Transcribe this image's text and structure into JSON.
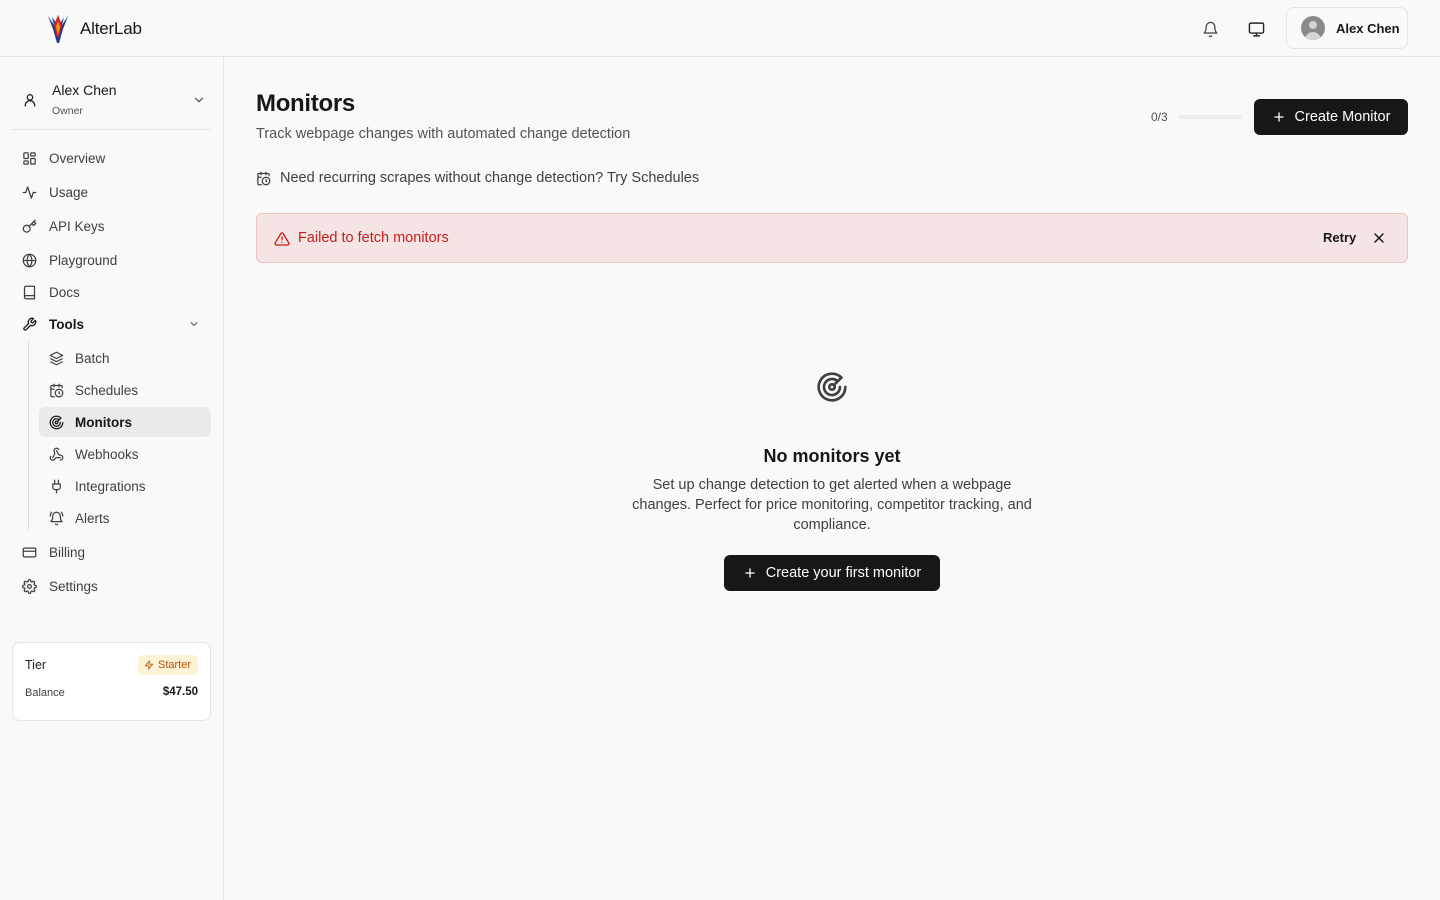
{
  "header": {
    "brand_name": "AlterLab",
    "logo_icon": "alterlab-logo",
    "notification_icon": "bell-icon",
    "display_icon": "monitor-icon",
    "user_name": "Alex Chen"
  },
  "sidebar": {
    "org": {
      "name": "Alex Chen",
      "role": "Owner"
    },
    "items": [
      {
        "label": "Overview",
        "icon": "layout-grid-icon"
      },
      {
        "label": "Usage",
        "icon": "activity-icon"
      },
      {
        "label": "API Keys",
        "icon": "key-icon"
      },
      {
        "label": "Playground",
        "icon": "globe-icon"
      },
      {
        "label": "Docs",
        "icon": "book-icon"
      },
      {
        "label": "Tools",
        "icon": "wrench-icon"
      }
    ],
    "tools": [
      {
        "label": "Batch",
        "icon": "layers-icon"
      },
      {
        "label": "Schedules",
        "icon": "calendar-clock-icon"
      },
      {
        "label": "Monitors",
        "icon": "radar-icon",
        "active": true
      },
      {
        "label": "Webhooks",
        "icon": "webhook-icon"
      },
      {
        "label": "Integrations",
        "icon": "plug-icon"
      },
      {
        "label": "Alerts",
        "icon": "bell-ring-icon"
      }
    ],
    "bottom_items": [
      {
        "label": "Billing",
        "icon": "credit-card-icon"
      },
      {
        "label": "Settings",
        "icon": "settings-icon"
      }
    ],
    "tier_card": {
      "tier_label": "Tier",
      "tier_value": "Starter",
      "balance_label": "Balance",
      "balance_value": "$47.50"
    }
  },
  "main": {
    "title": "Monitors",
    "subtitle": "Track webpage changes with automated change detection",
    "quota_text": "0/3",
    "quota_fraction": 0,
    "create_button": "Create Monitor",
    "hint_text": "Need recurring scrapes without change detection? Try Schedules",
    "alert": {
      "message": "Failed to fetch monitors",
      "retry_label": "Retry"
    },
    "empty_state": {
      "title": "No monitors yet",
      "description": "Set up change detection to get alerted when a webpage changes. Perfect for price monitoring, competitor tracking, and compliance.",
      "button": "Create your first monitor"
    }
  },
  "colors": {
    "primary": "#171717",
    "alert_bg": "#f5e4e4",
    "alert_text": "#c81e1e",
    "badge_bg": "#fdf1d6",
    "badge_text": "#b45309"
  }
}
